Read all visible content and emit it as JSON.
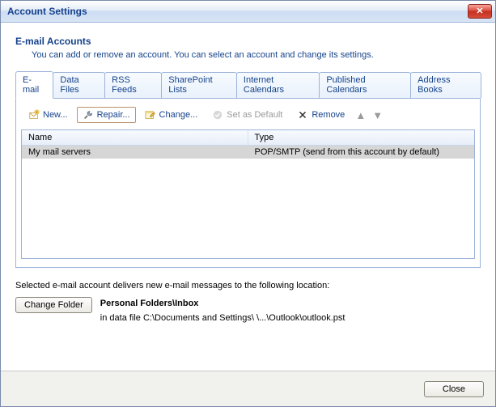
{
  "window": {
    "title": "Account Settings",
    "close_glyph": "✕"
  },
  "header": {
    "heading": "E-mail Accounts",
    "subtext": "You can add or remove an account. You can select an account and change its settings."
  },
  "tabs": [
    "E-mail",
    "Data Files",
    "RSS Feeds",
    "SharePoint Lists",
    "Internet Calendars",
    "Published Calendars",
    "Address Books"
  ],
  "toolbar": {
    "new": "New...",
    "repair": "Repair...",
    "change": "Change...",
    "set_default": "Set as Default",
    "remove": "Remove"
  },
  "list": {
    "cols": {
      "name": "Name",
      "type": "Type"
    },
    "rows": [
      {
        "name": "My mail servers",
        "type": "POP/SMTP (send from this account by default)"
      }
    ]
  },
  "delivery": {
    "label": "Selected e-mail account delivers new e-mail messages to the following location:",
    "change_folder": "Change Folder",
    "folder": "Personal Folders\\Inbox",
    "datafile_prefix": "in data file ",
    "datafile_path": "C:\\Documents and Settings\\        \\...\\Outlook\\outlook.pst"
  },
  "footer": {
    "close": "Close"
  }
}
